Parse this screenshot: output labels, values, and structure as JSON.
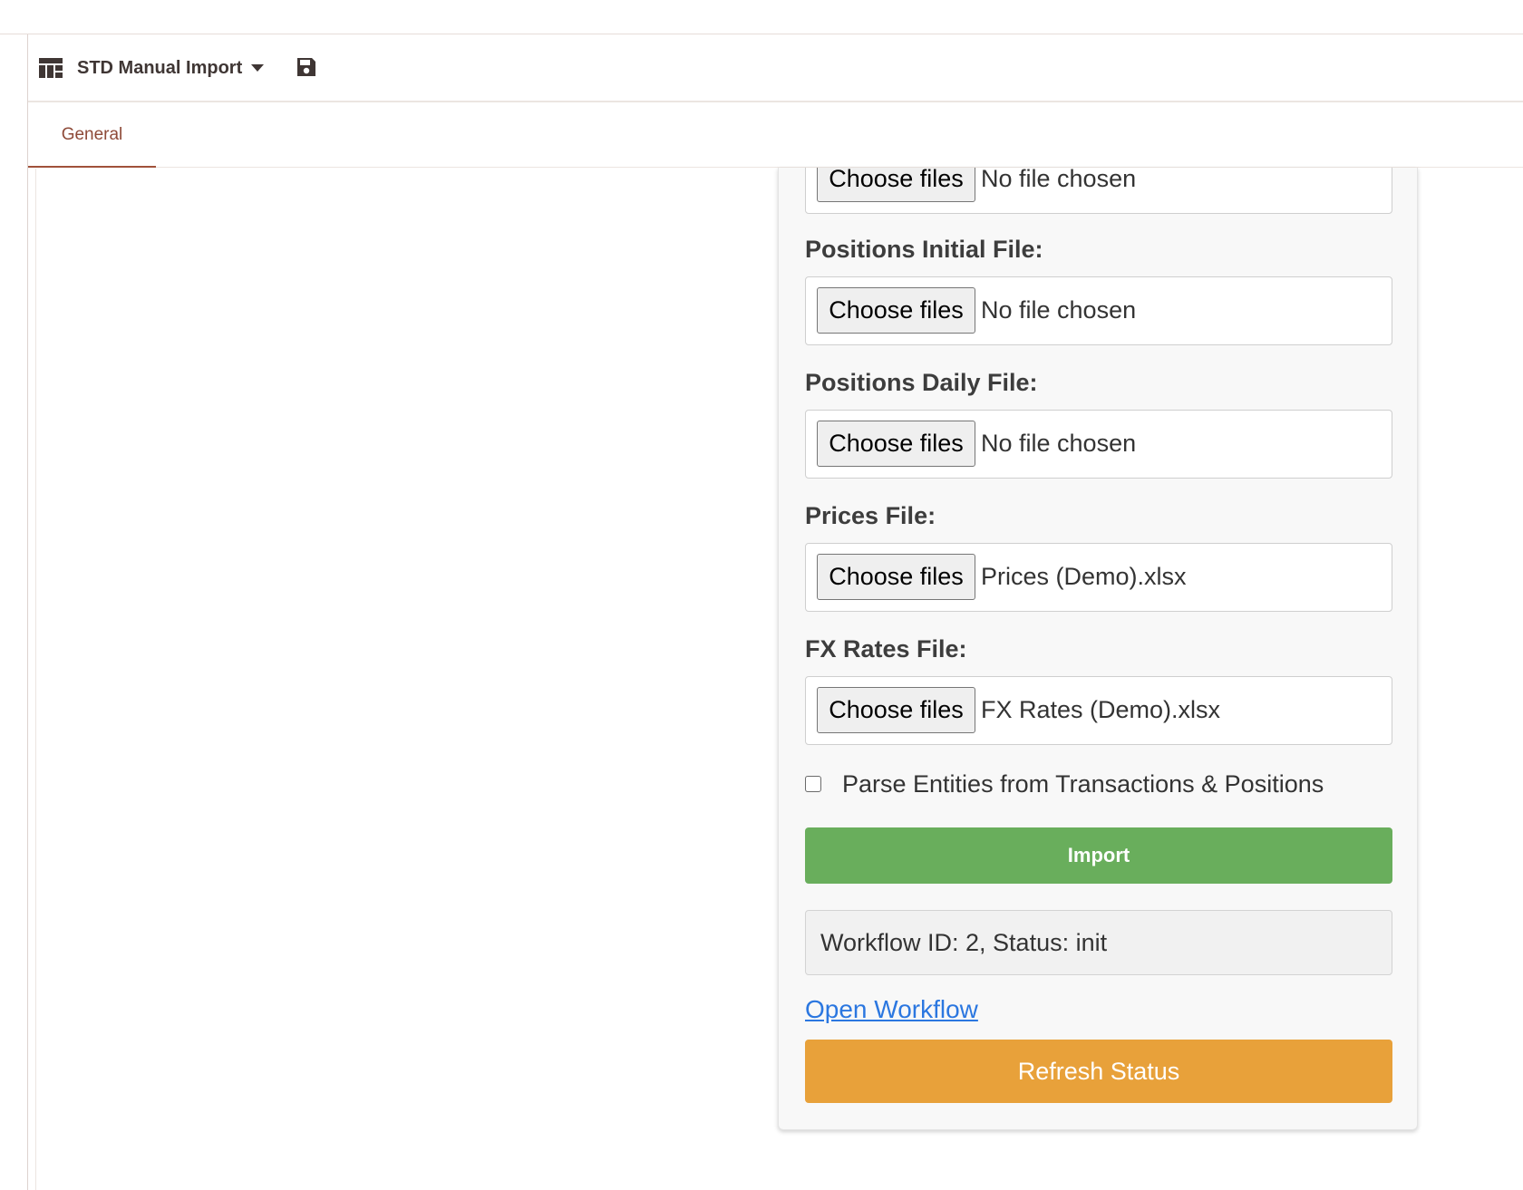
{
  "toolbar": {
    "title": "STD Manual Import",
    "dashboard_icon": "dashboard-icon",
    "dropdown_icon": "caret-down-icon",
    "save_icon": "save-icon"
  },
  "tabs": [
    {
      "label": "General",
      "active": true
    }
  ],
  "form": {
    "choose_label": "Choose files",
    "fields": [
      {
        "label": "",
        "file": "No file chosen"
      },
      {
        "label": "Positions Initial File:",
        "file": "No file chosen"
      },
      {
        "label": "Positions Daily File:",
        "file": "No file chosen"
      },
      {
        "label": "Prices File:",
        "file": "Prices (Demo).xlsx"
      },
      {
        "label": "FX Rates File:",
        "file": "FX Rates (Demo).xlsx"
      }
    ],
    "checkbox_label": "Parse Entities from Transactions & Positions",
    "checkbox_checked": false,
    "import_label": "Import",
    "status_text": "Workflow ID: 2, Status: init",
    "open_workflow_label": "Open Workflow",
    "refresh_label": "Refresh Status"
  },
  "colors": {
    "accent_tab": "#a0513a",
    "import_green": "#69ae5c",
    "refresh_orange": "#e8a13a",
    "link_blue": "#2b77e0"
  }
}
